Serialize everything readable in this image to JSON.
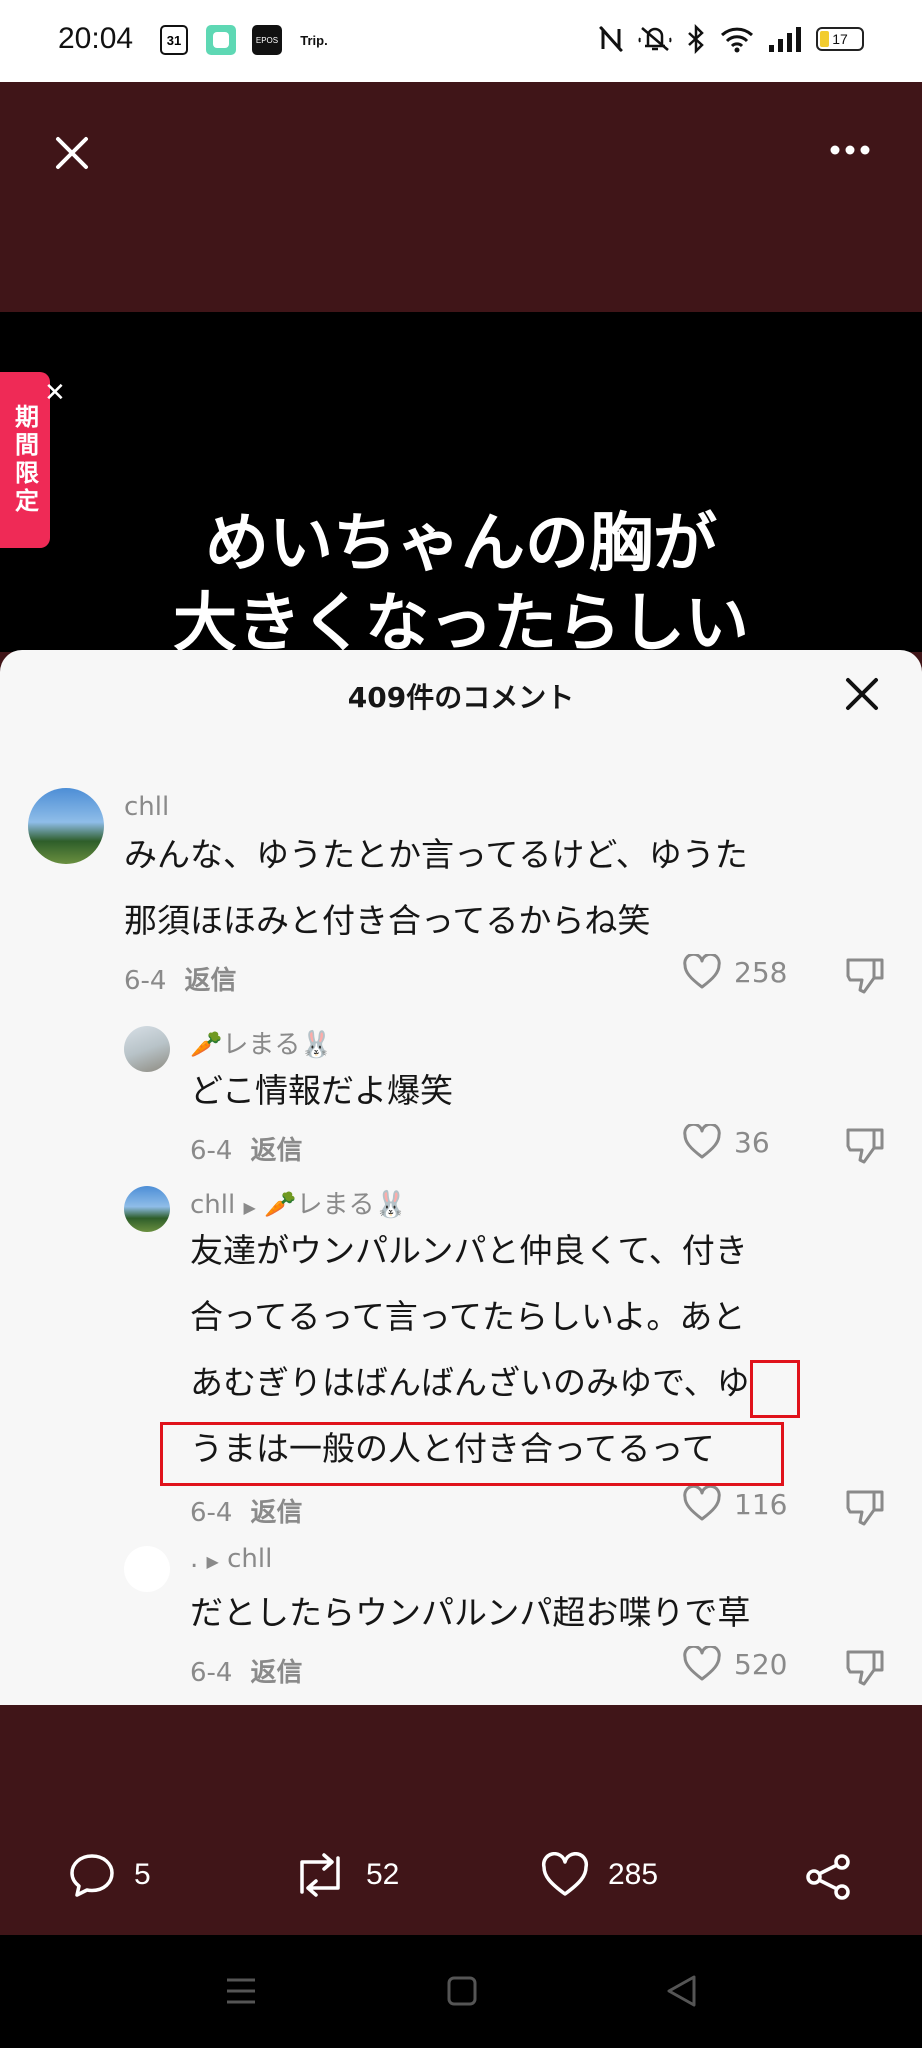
{
  "status_bar": {
    "time": "20:04",
    "calendar_label": "31",
    "epos_label": "EPOS",
    "trip_label": "Trip.",
    "battery": "17"
  },
  "video": {
    "title_line1": "めいちゃんの胸が",
    "title_line2": "大きくなったらしい",
    "promo_label": "期間限定"
  },
  "comments_sheet": {
    "title": "409件のコメント",
    "comments": [
      {
        "username": "chll",
        "text_line1": "みんな、ゆうたとか言ってるけど、ゆうた",
        "text_line2": "那須ほほみと付き合ってるからね笑",
        "date": "6-4",
        "reply": "返信",
        "likes": "258"
      },
      {
        "username": "🥕レまる🐰",
        "text_line1": "どこ情報だよ爆笑",
        "date": "6-4",
        "reply": "返信",
        "likes": "36"
      },
      {
        "username": "chll",
        "reply_to": "🥕レまる🐰",
        "text_line1": "友達がウンパルンパと仲良くて、付き",
        "text_line2": "合ってるって言ってたらしいよ。あと",
        "text_line3": "あむぎりはばんばんざいのみゆで、ゆ",
        "text_line4": "うまは一般の人と付き合ってるって",
        "date": "6-4",
        "reply": "返信",
        "likes": "116"
      },
      {
        "username": ".",
        "reply_to": "chll",
        "text_line1": "だとしたらウンパルンパ超お喋りで草",
        "date": "6-4",
        "reply": "返信",
        "likes": "520"
      }
    ]
  },
  "action_bar": {
    "comments": "5",
    "reposts": "52",
    "likes": "285"
  },
  "colors": {
    "background": "#401518",
    "sheet": "#f7f7f7",
    "highlight": "#e0121b",
    "promo": "#ef2a56"
  }
}
